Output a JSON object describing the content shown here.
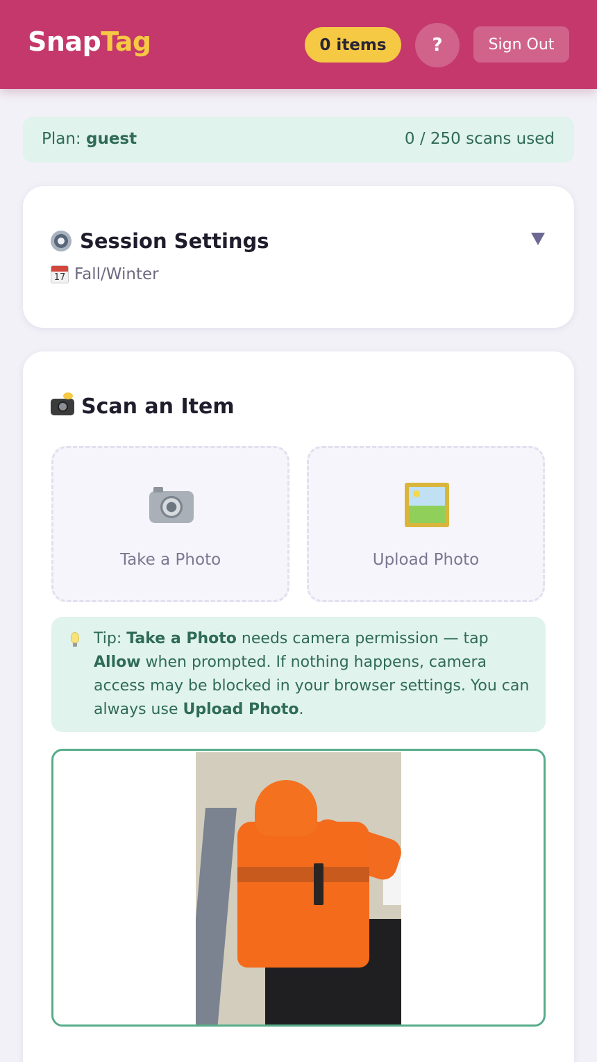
{
  "header": {
    "logo_part1": "Snap",
    "logo_part2": "Tag",
    "items_count": "0 items",
    "help_label": "?",
    "signout_label": "Sign Out"
  },
  "plan": {
    "label": "Plan: ",
    "value": "guest",
    "usage": "0 / 250 scans used"
  },
  "settings": {
    "title": "Session Settings",
    "season": "Fall/Winter",
    "calendar_day": "17",
    "toggle_icon": "caret-down-icon"
  },
  "scan": {
    "title": "Scan an Item",
    "take_photo": "Take a Photo",
    "upload_photo": "Upload Photo",
    "tip": {
      "prefix": "Tip: ",
      "take_photo": "Take a Photo",
      "mid1": " needs camera permission — tap ",
      "allow": "Allow",
      "mid2": " when prompted. If nothing happens, camera access may be blocked in your browser settings. You can always use ",
      "upload_photo": "Upload Photo",
      "suffix": "."
    }
  },
  "colors": {
    "brand": "#c4386b",
    "accent_yellow": "#f6c944",
    "tip_bg": "#e0f3ec",
    "preview_border": "#57ad8a"
  }
}
